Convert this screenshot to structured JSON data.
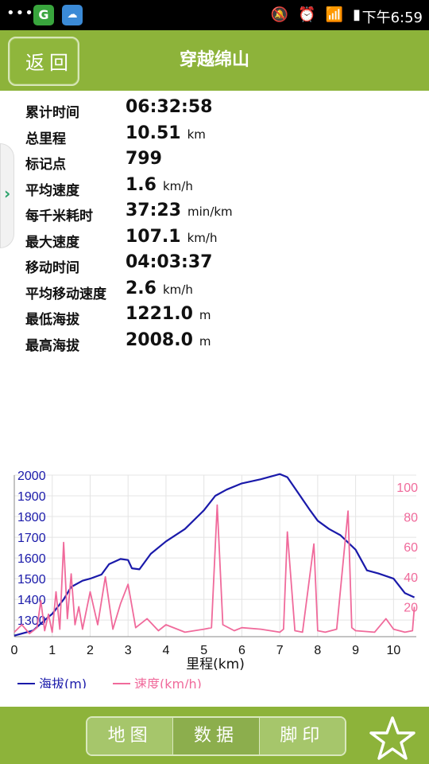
{
  "status_bar": {
    "dots": "•••",
    "app1": "G",
    "app2": "☁",
    "time": "下午6:59"
  },
  "header": {
    "back_label": "返回",
    "title": "穿越绵山"
  },
  "stats": [
    {
      "label": "累计时间",
      "value": "06:32:58",
      "unit": ""
    },
    {
      "label": "总里程",
      "value": "10.51",
      "unit": "km"
    },
    {
      "label": "标记点",
      "value": "799",
      "unit": ""
    },
    {
      "label": "平均速度",
      "value": "1.6",
      "unit": "km/h"
    },
    {
      "label": "每千米耗时",
      "value": "37:23",
      "unit": "min/km"
    },
    {
      "label": "最大速度",
      "value": "107.1",
      "unit": "km/h"
    },
    {
      "label": "移动时间",
      "value": "04:03:37",
      "unit": ""
    },
    {
      "label": "平均移动速度",
      "value": "2.6",
      "unit": "km/h"
    },
    {
      "label": "最低海拔",
      "value": "1221.0",
      "unit": "m"
    },
    {
      "label": "最高海拔",
      "value": "2008.0",
      "unit": "m"
    }
  ],
  "chart_data": {
    "type": "line",
    "xlabel": "里程(km)",
    "x_ticks": [
      "0",
      "1",
      "2",
      "3",
      "4",
      "5",
      "6",
      "7",
      "8",
      "9",
      "10"
    ],
    "xlim": [
      0,
      10.6
    ],
    "y_left_ticks": [
      "1300",
      "1400",
      "1500",
      "1600",
      "1700",
      "1800",
      "1900",
      "2000"
    ],
    "ylim_left": [
      1220,
      2000
    ],
    "y_right_ticks": [
      "20",
      "40",
      "60",
      "80",
      "100"
    ],
    "ylim_right": [
      0,
      108
    ],
    "series": [
      {
        "name": "海拔(m)",
        "axis": "left",
        "color": "#1a1aaa",
        "x": [
          0,
          0.3,
          0.5,
          0.8,
          1.0,
          1.3,
          1.5,
          1.8,
          2.0,
          2.3,
          2.5,
          2.8,
          3.0,
          3.1,
          3.3,
          3.6,
          4.0,
          4.5,
          5.0,
          5.3,
          5.6,
          6.0,
          6.5,
          7.0,
          7.2,
          7.5,
          7.8,
          8.0,
          8.3,
          8.6,
          9.0,
          9.3,
          9.6,
          10.0,
          10.3,
          10.55
        ],
        "y": [
          1225,
          1240,
          1250,
          1300,
          1330,
          1400,
          1460,
          1490,
          1500,
          1520,
          1570,
          1595,
          1590,
          1550,
          1545,
          1620,
          1680,
          1740,
          1830,
          1900,
          1930,
          1960,
          1980,
          2005,
          1990,
          1910,
          1830,
          1780,
          1740,
          1710,
          1640,
          1540,
          1525,
          1500,
          1430,
          1410
        ]
      },
      {
        "name": "速度(km/h)",
        "axis": "right",
        "color": "#f06a9b",
        "x": [
          0,
          0.2,
          0.4,
          0.6,
          0.7,
          0.8,
          0.9,
          1.0,
          1.1,
          1.2,
          1.3,
          1.4,
          1.5,
          1.6,
          1.7,
          1.8,
          2.0,
          2.2,
          2.4,
          2.6,
          2.8,
          3.0,
          3.2,
          3.5,
          3.8,
          4.0,
          4.5,
          5.0,
          5.2,
          5.35,
          5.5,
          5.8,
          6.0,
          6.5,
          7.0,
          7.1,
          7.2,
          7.4,
          7.6,
          7.9,
          8.0,
          8.2,
          8.5,
          8.8,
          8.9,
          9.0,
          9.5,
          9.8,
          10.0,
          10.3,
          10.5,
          10.55
        ],
        "y": [
          3,
          8,
          2,
          6,
          24,
          4,
          15,
          3,
          30,
          5,
          63,
          12,
          42,
          8,
          20,
          5,
          30,
          8,
          40,
          5,
          22,
          35,
          6,
          12,
          4,
          8,
          3,
          5,
          6,
          88,
          8,
          4,
          6,
          5,
          3,
          5,
          70,
          4,
          3,
          62,
          4,
          3,
          5,
          84,
          6,
          4,
          3,
          12,
          5,
          3,
          4,
          20
        ]
      }
    ]
  }
}
